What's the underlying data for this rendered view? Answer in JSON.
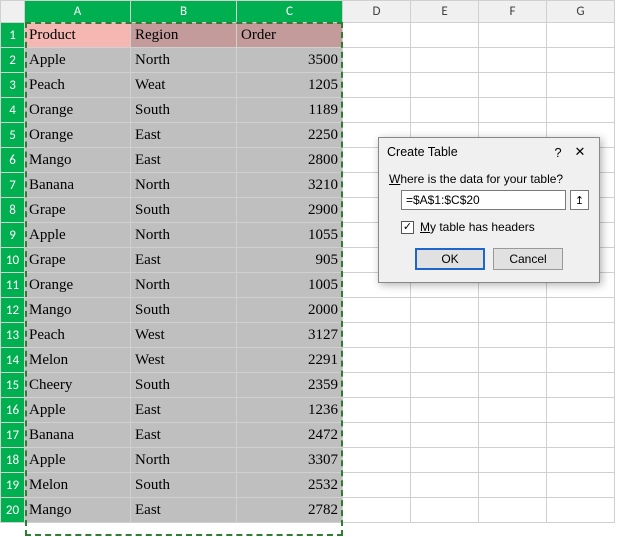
{
  "columns": [
    "A",
    "B",
    "C",
    "D",
    "E",
    "F",
    "G"
  ],
  "headers": {
    "A": "Product",
    "B": "Region",
    "C": "Order"
  },
  "rows": [
    {
      "n": 1
    },
    {
      "n": 2,
      "A": "Apple",
      "B": "North",
      "C": 3500
    },
    {
      "n": 3,
      "A": "Peach",
      "B": "Weat",
      "C": 1205
    },
    {
      "n": 4,
      "A": "Orange",
      "B": "South",
      "C": 1189
    },
    {
      "n": 5,
      "A": "Orange",
      "B": "East",
      "C": 2250
    },
    {
      "n": 6,
      "A": "Mango",
      "B": "East",
      "C": 2800
    },
    {
      "n": 7,
      "A": "Banana",
      "B": "North",
      "C": 3210
    },
    {
      "n": 8,
      "A": "Grape",
      "B": "South",
      "C": 2900
    },
    {
      "n": 9,
      "A": "Apple",
      "B": "North",
      "C": 1055
    },
    {
      "n": 10,
      "A": "Grape",
      "B": "East",
      "C": 905
    },
    {
      "n": 11,
      "A": "Orange",
      "B": "North",
      "C": 1005
    },
    {
      "n": 12,
      "A": "Mango",
      "B": "South",
      "C": 2000
    },
    {
      "n": 13,
      "A": "Peach",
      "B": "West",
      "C": 3127
    },
    {
      "n": 14,
      "A": "Melon",
      "B": "West",
      "C": 2291
    },
    {
      "n": 15,
      "A": "Cheery",
      "B": "South",
      "C": 2359
    },
    {
      "n": 16,
      "A": "Apple",
      "B": "East",
      "C": 1236
    },
    {
      "n": 17,
      "A": "Banana",
      "B": "East",
      "C": 2472
    },
    {
      "n": 18,
      "A": "Apple",
      "B": "North",
      "C": 3307
    },
    {
      "n": 19,
      "A": "Melon",
      "B": "South",
      "C": 2532
    },
    {
      "n": 20,
      "A": "Mango",
      "B": "East",
      "C": 2782
    }
  ],
  "dialog": {
    "title": "Create Table",
    "help": "?",
    "close": "✕",
    "prompt_pre": "W",
    "prompt_rest": "here is the data for your table?",
    "range_value": "=$A$1:$C$20",
    "picker_glyph": "↥",
    "checkbox_checked": true,
    "check_glyph": "✓",
    "check_pre": "M",
    "check_rest": "y table has headers",
    "ok": "OK",
    "cancel": "Cancel"
  },
  "chart_data": {
    "type": "table",
    "title": "",
    "columns": [
      "Product",
      "Region",
      "Order"
    ],
    "rows": [
      [
        "Apple",
        "North",
        3500
      ],
      [
        "Peach",
        "Weat",
        1205
      ],
      [
        "Orange",
        "South",
        1189
      ],
      [
        "Orange",
        "East",
        2250
      ],
      [
        "Mango",
        "East",
        2800
      ],
      [
        "Banana",
        "North",
        3210
      ],
      [
        "Grape",
        "South",
        2900
      ],
      [
        "Apple",
        "North",
        1055
      ],
      [
        "Grape",
        "East",
        905
      ],
      [
        "Orange",
        "North",
        1005
      ],
      [
        "Mango",
        "South",
        2000
      ],
      [
        "Peach",
        "West",
        3127
      ],
      [
        "Melon",
        "West",
        2291
      ],
      [
        "Cheery",
        "South",
        2359
      ],
      [
        "Apple",
        "East",
        1236
      ],
      [
        "Banana",
        "East",
        2472
      ],
      [
        "Apple",
        "North",
        3307
      ],
      [
        "Melon",
        "South",
        2532
      ],
      [
        "Mango",
        "East",
        2782
      ]
    ]
  }
}
